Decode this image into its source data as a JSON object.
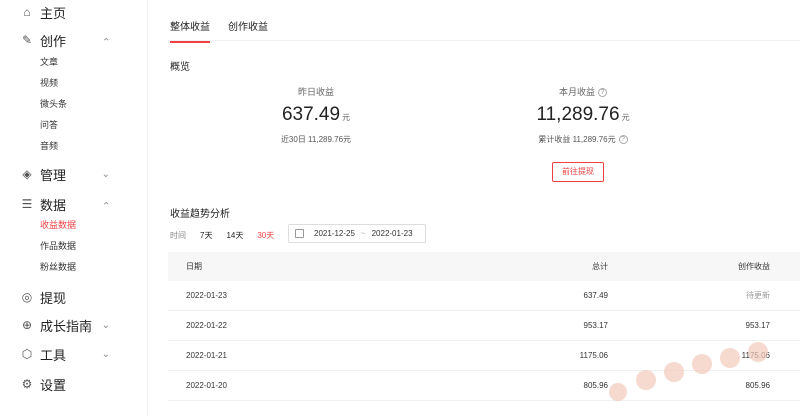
{
  "sidebar": {
    "items": [
      {
        "icon": "home-icon",
        "label": "主页"
      },
      {
        "icon": "pen-icon",
        "label": "创作",
        "children": [
          "文章",
          "视频",
          "微头条",
          "问答",
          "音频"
        ]
      },
      {
        "icon": "layers-icon",
        "label": "管理"
      },
      {
        "icon": "database-icon",
        "label": "数据",
        "children": [
          "收益数据",
          "作品数据",
          "粉丝数据"
        ]
      },
      {
        "icon": "coin-icon",
        "label": "提现"
      },
      {
        "icon": "compass-icon",
        "label": "成长指南"
      },
      {
        "icon": "cube-icon",
        "label": "工具"
      },
      {
        "icon": "gear-icon",
        "label": "设置"
      }
    ]
  },
  "tabs": [
    "整体收益",
    "创作收益"
  ],
  "overview": {
    "title": "概览",
    "yesterday": {
      "label": "昨日收益",
      "value": "637.49",
      "unit": "元",
      "sub": "近30日 11,289.76元"
    },
    "month": {
      "label": "本月收益",
      "value": "11,289.76",
      "unit": "元",
      "sub": "累计收益 11,289.76元"
    },
    "withdraw_label": "前往提现"
  },
  "trend": {
    "title": "收益趋势分析",
    "time_label": "时间",
    "options": [
      "7天",
      "14天",
      "30天"
    ],
    "date_start": "2021-12-25",
    "date_sep": "~",
    "date_end": "2022-01-23"
  },
  "table": {
    "headers": [
      "日期",
      "总计",
      "创作收益"
    ],
    "rows": [
      [
        "2022-01-23",
        "637.49",
        "待更新"
      ],
      [
        "2022-01-22",
        "953.17",
        "953.17"
      ],
      [
        "2022-01-21",
        "1175.06",
        "1175.06"
      ],
      [
        "2022-01-20",
        "805.96",
        "805.96"
      ]
    ]
  },
  "colors": {
    "accent": "#f04142"
  }
}
